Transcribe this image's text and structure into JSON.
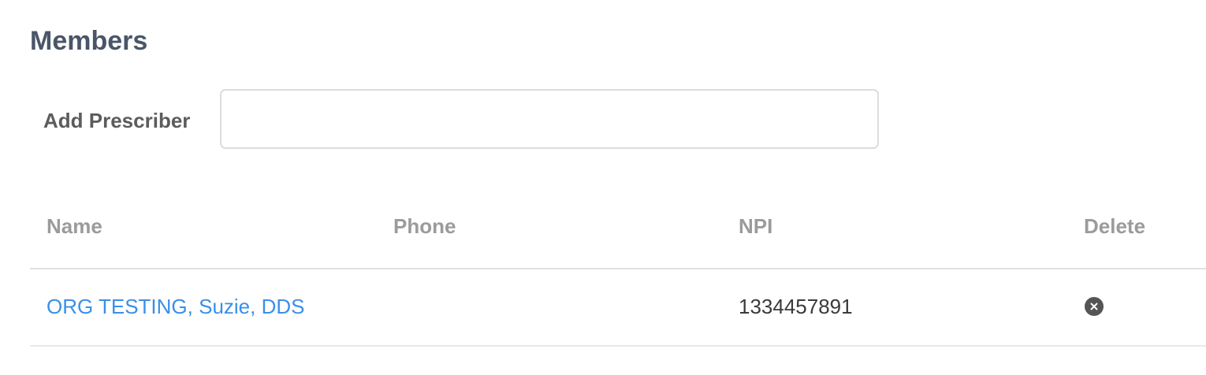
{
  "page": {
    "title": "Members"
  },
  "add_prescriber": {
    "label": "Add Prescriber",
    "value": "",
    "placeholder": ""
  },
  "table": {
    "columns": {
      "name": "Name",
      "phone": "Phone",
      "npi": "NPI",
      "delete": "Delete"
    },
    "rows": [
      {
        "name": "ORG TESTING, Suzie, DDS",
        "phone": "",
        "npi": "1334457891",
        "delete_icon": "close-circle-icon"
      }
    ]
  },
  "colors": {
    "title": "#4a5568",
    "link": "#3b8fe8",
    "header_text": "#9b9b9b",
    "delete_icon_bg": "#555555"
  }
}
